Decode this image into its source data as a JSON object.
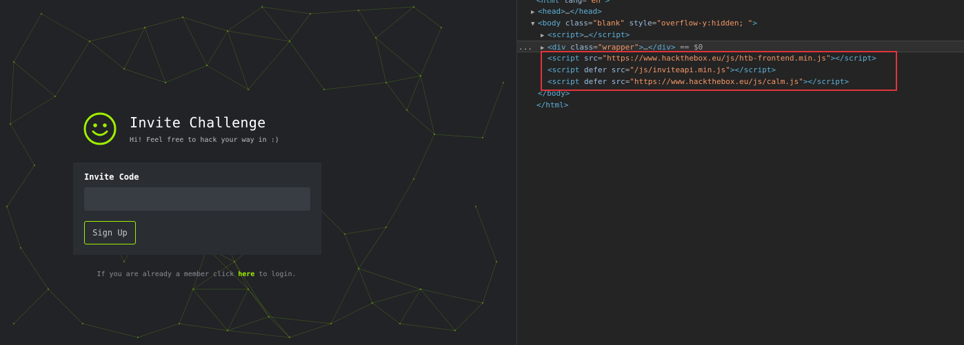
{
  "page": {
    "title": "Invite Challenge",
    "subtitle": "Hi! Feel free to hack your way in :)",
    "invite_label": "Invite Code",
    "invite_value": "",
    "signup_label": "Sign Up",
    "footer_before": "If you are already a member click ",
    "footer_link": "here",
    "footer_after": " to login.",
    "accent_color": "#9fef00"
  },
  "devtools": {
    "lines": [
      {
        "indent": 0,
        "tri": "",
        "html": "<span class='t'>&lt;html</span> <span class='a'>lang</span><span class='p'>=</span><span class='v'>\"en\"</span><span class='t'>&gt;</span>"
      },
      {
        "indent": 1,
        "tri": "▶",
        "html": "<span class='t'>&lt;head&gt;</span><span class='p'>…</span><span class='t'>&lt;/head&gt;</span>"
      },
      {
        "indent": 1,
        "tri": "▼",
        "html": "<span class='t'>&lt;body</span> <span class='a'>class</span><span class='p'>=</span><span class='v'>\"blank\"</span> <span class='a'>style</span><span class='p'>=</span><span class='v'>\"overflow-y:hidden; \"</span><span class='t'>&gt;</span>"
      },
      {
        "indent": 2,
        "tri": "▶",
        "html": "<span class='t'>&lt;script&gt;</span><span class='p'>…</span><span class='t'>&lt;/script&gt;</span>"
      },
      {
        "indent": 2,
        "tri": "▶",
        "sel": true,
        "html": "<span class='t'>&lt;div</span> <span class='a'>class</span><span class='p'>=</span><span class='v'>\"wrapper\"</span><span class='t'>&gt;</span><span class='p'>…</span><span class='t'>&lt;/div&gt;</span> <span class='p'>== $0</span>"
      },
      {
        "indent": 2,
        "tri": "",
        "html": "<span class='t'>&lt;script</span> <span class='a'>src</span><span class='p'>=</span><span class='v'>\"https://www.hackthebox.eu/js/htb-frontend.min.js\"</span><span class='t'>&gt;&lt;/script&gt;</span>"
      },
      {
        "indent": 2,
        "tri": "",
        "html": "<span class='t'>&lt;script</span> <span class='a'>defer src</span><span class='p'>=</span><span class='v'>\"/js/inviteapi.min.js\"</span><span class='t'>&gt;&lt;/script&gt;</span>"
      },
      {
        "indent": 2,
        "tri": "",
        "html": "<span class='t'>&lt;script</span> <span class='a'>defer src</span><span class='p'>=</span><span class='v'>\"https://www.hackthebox.eu/js/calm.js\"</span><span class='t'>&gt;&lt;/script&gt;</span>"
      },
      {
        "indent": 1,
        "tri": "",
        "html": "<span class='t'>&lt;/body&gt;</span>"
      },
      {
        "indent": 0,
        "tri": "",
        "html": "<span class='t'>&lt;/html&gt;</span>"
      }
    ],
    "selected_marker": "..."
  }
}
